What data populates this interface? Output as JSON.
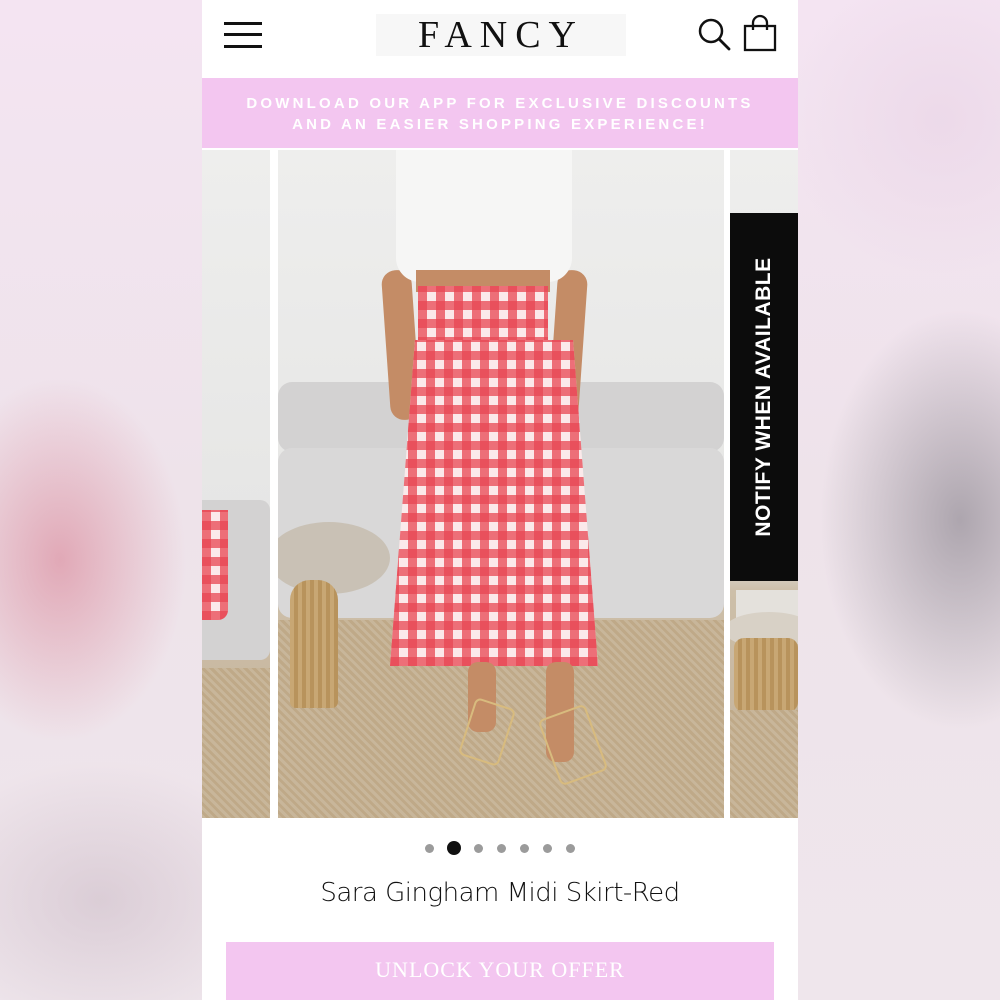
{
  "header": {
    "logo": "FANCY",
    "menu_icon": "hamburger-menu-icon",
    "search_icon": "search-icon",
    "cart_icon": "shopping-bag-icon"
  },
  "promo": {
    "line1": "DOWNLOAD OUR APP FOR EXCLUSIVE DISCOUNTS",
    "line2": "AND AN EASIER SHOPPING EXPERIENCE!"
  },
  "gallery": {
    "notify_label": "NOTIFY WHEN AVAILABLE",
    "zoom_icon": "zoom-icon",
    "slide_count": 7,
    "active_slide": 2
  },
  "product": {
    "title": "Sara Gingham Midi Skirt-Red"
  },
  "cta": {
    "label": "UNLOCK YOUR OFFER"
  },
  "colors": {
    "promo_bg": "#f3c6f0",
    "notify_bg": "#0c0c0c",
    "active_dot": "#111111",
    "inactive_dot": "#9b9b9b"
  }
}
